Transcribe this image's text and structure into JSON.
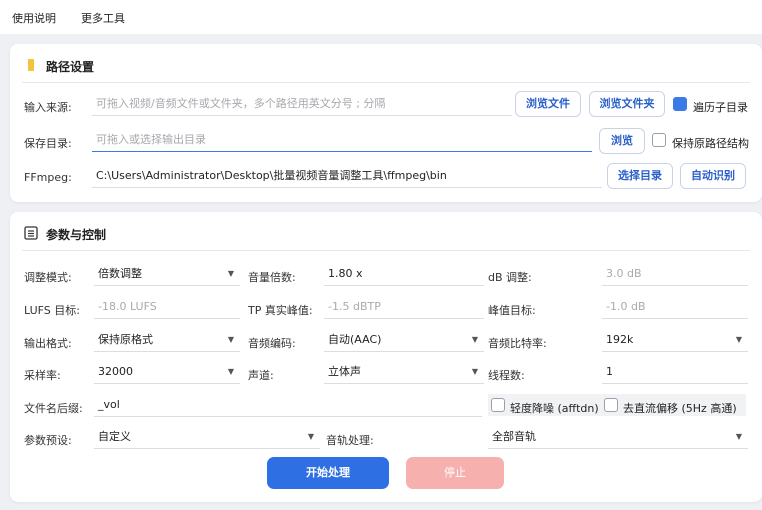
{
  "menu": {
    "usage": "使用说明",
    "more_tools": "更多工具"
  },
  "path_section": {
    "title": "路径设置",
    "input_source": {
      "label": "输入来源:",
      "placeholder": "可拖入视频/音频文件或文件夹，多个路径用英文分号 ; 分隔",
      "browse_file": "浏览文件",
      "browse_folder": "浏览文件夹",
      "traverse_subdirs": {
        "label": "遍历子目录",
        "checked": true
      }
    },
    "save_dir": {
      "label": "保存目录:",
      "placeholder": "可拖入或选择输出目录",
      "browse": "浏览",
      "keep_structure": {
        "label": "保持原路径结构",
        "checked": false
      }
    },
    "ffmpeg": {
      "label": "FFmpeg:",
      "value": "C:\\Users\\Administrator\\Desktop\\批量视频音量调整工具\\ffmpeg\\bin",
      "select_dir": "选择目录",
      "auto_detect": "自动识别"
    }
  },
  "params_section": {
    "title": "参数与控制",
    "adjust_mode": {
      "label": "调整模式:",
      "value": "倍数调整"
    },
    "volume_multiplier": {
      "label": "音量倍数:",
      "value": "1.80 x"
    },
    "db_adjust": {
      "label": "dB 调整:",
      "value": "3.0 dB"
    },
    "lufs_target": {
      "label": "LUFS 目标:",
      "value": "-18.0 LUFS"
    },
    "tp_peak": {
      "label": "TP 真实峰值:",
      "value": "-1.5 dBTP"
    },
    "peak_target": {
      "label": "峰值目标:",
      "value": "-1.0 dB"
    },
    "output_format": {
      "label": "输出格式:",
      "value": "保持原格式"
    },
    "audio_codec": {
      "label": "音频编码:",
      "value": "自动(AAC)"
    },
    "audio_bitrate": {
      "label": "音频比特率:",
      "value": "192k"
    },
    "sample_rate": {
      "label": "采样率:",
      "value": "32000"
    },
    "channels": {
      "label": "声道:",
      "value": "立体声"
    },
    "threads": {
      "label": "线程数:",
      "value": "1"
    },
    "filename_suffix": {
      "label": "文件名后缀:",
      "value": "_vol"
    },
    "light_denoise": {
      "label": "轻度降噪 (afftdn)",
      "checked": false
    },
    "dc_offset": {
      "label": "去直流偏移 (5Hz 高通)",
      "checked": false
    },
    "preset": {
      "label": "参数预设:",
      "value": "自定义"
    },
    "track_processing": {
      "label": "音轨处理:",
      "value": "全部音轨"
    },
    "start_button": "开始处理",
    "stop_button": "停止"
  },
  "colors": {
    "accent": "#2f6fe4",
    "stop": "#f6b0ae",
    "checked": "#3a7be6",
    "folder_icon": "#f5c33b"
  }
}
